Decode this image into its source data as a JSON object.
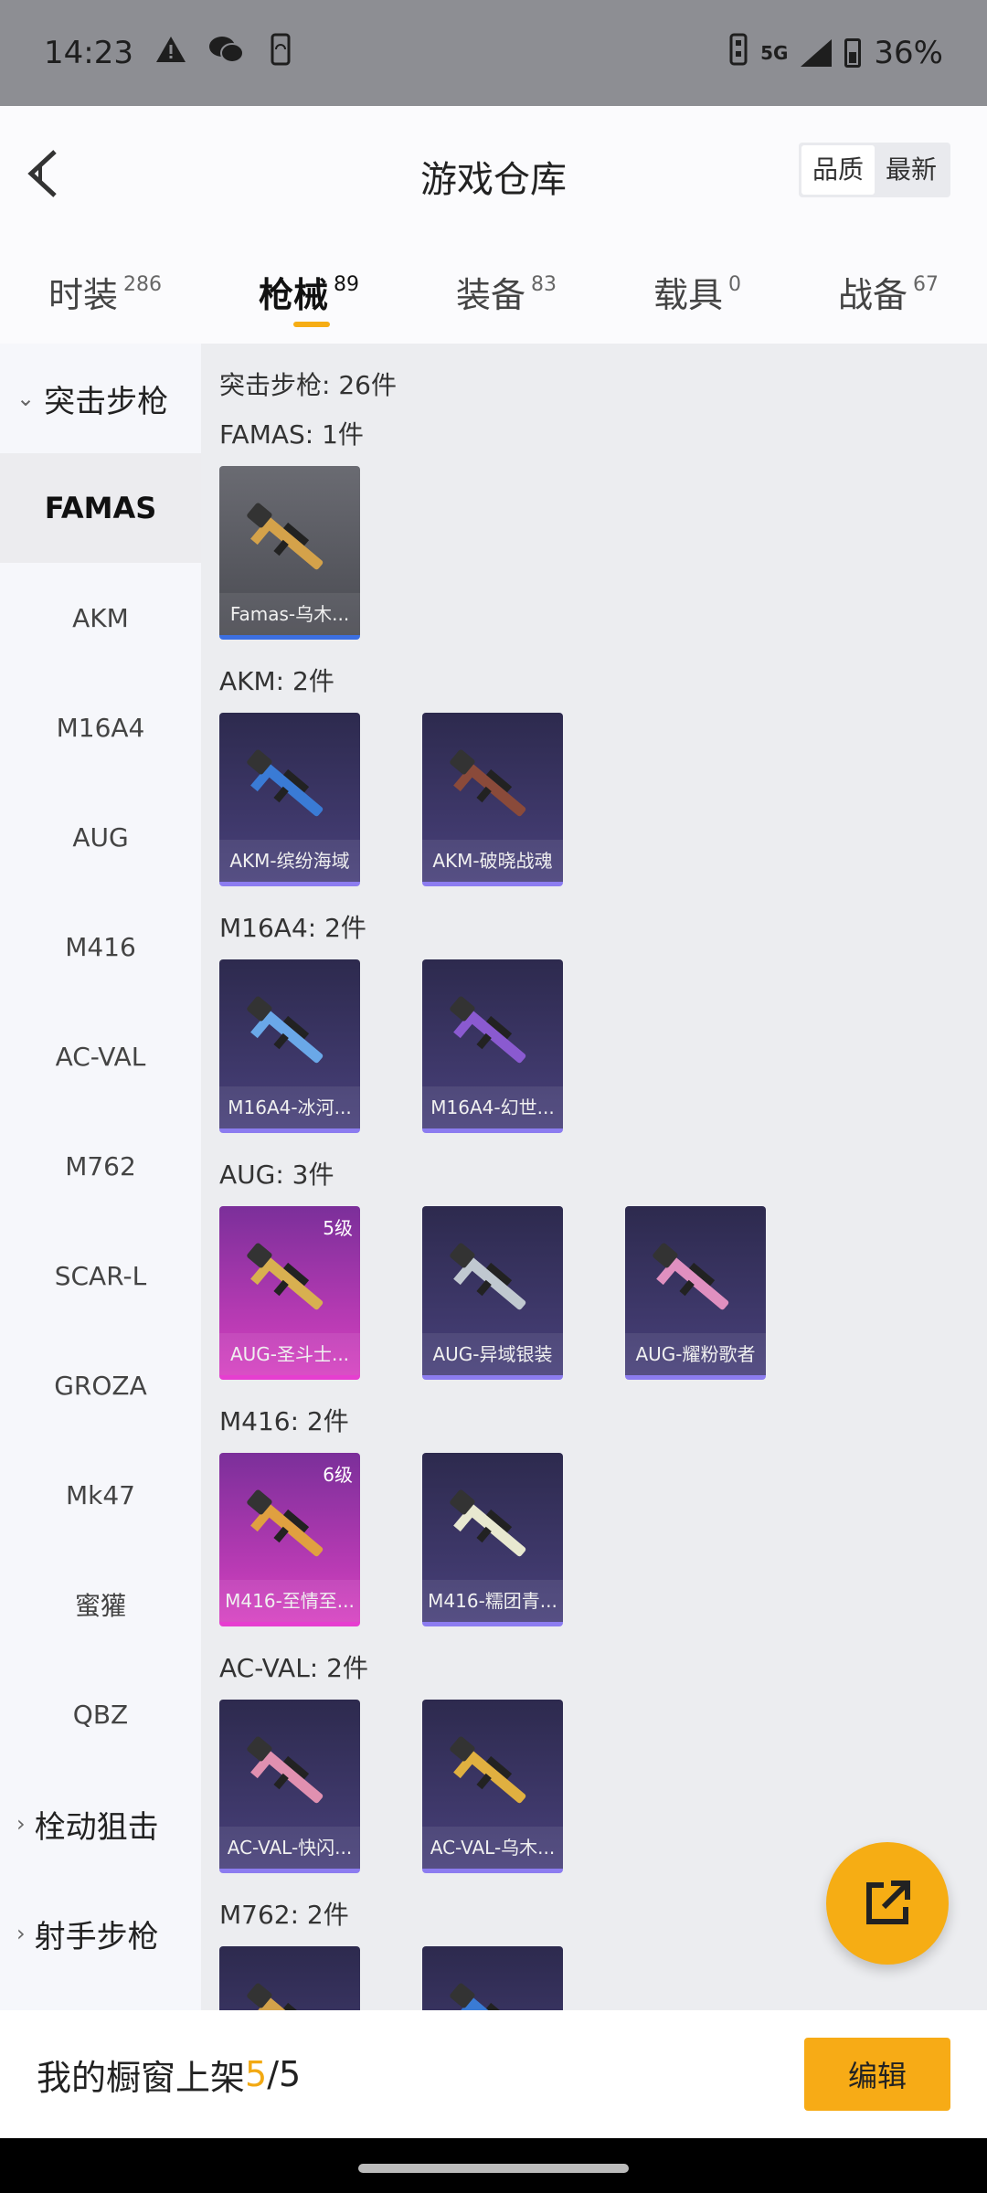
{
  "status": {
    "time": "14:23",
    "network": "5G",
    "battery": "36%"
  },
  "header": {
    "title": "游戏仓库",
    "sort_quality": "品质",
    "sort_newest": "最新"
  },
  "tabs": [
    {
      "label": "时装",
      "count": "286"
    },
    {
      "label": "枪械",
      "count": "89"
    },
    {
      "label": "装备",
      "count": "83"
    },
    {
      "label": "载具",
      "count": "0"
    },
    {
      "label": "战备",
      "count": "67"
    }
  ],
  "sidebar": {
    "group_assault": "突击步枪",
    "items": [
      "FAMAS",
      "AKM",
      "M16A4",
      "AUG",
      "M416",
      "AC-VAL",
      "M762",
      "SCAR-L",
      "GROZA",
      "Mk47",
      "蜜獾",
      "QBZ"
    ],
    "group_bolt": "栓动狙击",
    "group_marksman": "射手步枪"
  },
  "content": {
    "total": "突击步枪: 26件",
    "sections": [
      {
        "title": "FAMAS: 1件",
        "cards": [
          {
            "name": "Famas-乌木...",
            "color": "#55565d"
          }
        ]
      },
      {
        "title": "AKM: 2件",
        "cards": [
          {
            "name": "AKM-缤纷海域",
            "color": "#3a3463"
          },
          {
            "name": "AKM-破晓战魂",
            "color": "#3a3463"
          }
        ]
      },
      {
        "title": "M16A4: 2件",
        "cards": [
          {
            "name": "M16A4-冰河...",
            "color": "#3a3463"
          },
          {
            "name": "M16A4-幻世...",
            "color": "#3a3463"
          }
        ]
      },
      {
        "title": "AUG: 3件",
        "cards": [
          {
            "name": "AUG-圣斗士...",
            "level": "5级",
            "color": "#b83ab4"
          },
          {
            "name": "AUG-异域银装",
            "color": "#3a3463"
          },
          {
            "name": "AUG-耀粉歌者",
            "color": "#3a3463"
          }
        ]
      },
      {
        "title": "M416: 2件",
        "cards": [
          {
            "name": "M416-至情至...",
            "level": "6级",
            "color": "#b83ab4"
          },
          {
            "name": "M416-糯团青...",
            "color": "#3a3463"
          }
        ]
      },
      {
        "title": "AC-VAL: 2件",
        "cards": [
          {
            "name": "AC-VAL-快闪...",
            "color": "#3a3463"
          },
          {
            "name": "AC-VAL-乌木...",
            "color": "#3a3463"
          }
        ]
      },
      {
        "title": "M762: 2件",
        "cards": [
          {
            "name": "",
            "color": "#3a3463"
          },
          {
            "name": "",
            "color": "#3a3463"
          }
        ]
      }
    ]
  },
  "bottom": {
    "label": "我的橱窗上架 ",
    "count": "5",
    "total": "/5",
    "edit": "编辑"
  }
}
